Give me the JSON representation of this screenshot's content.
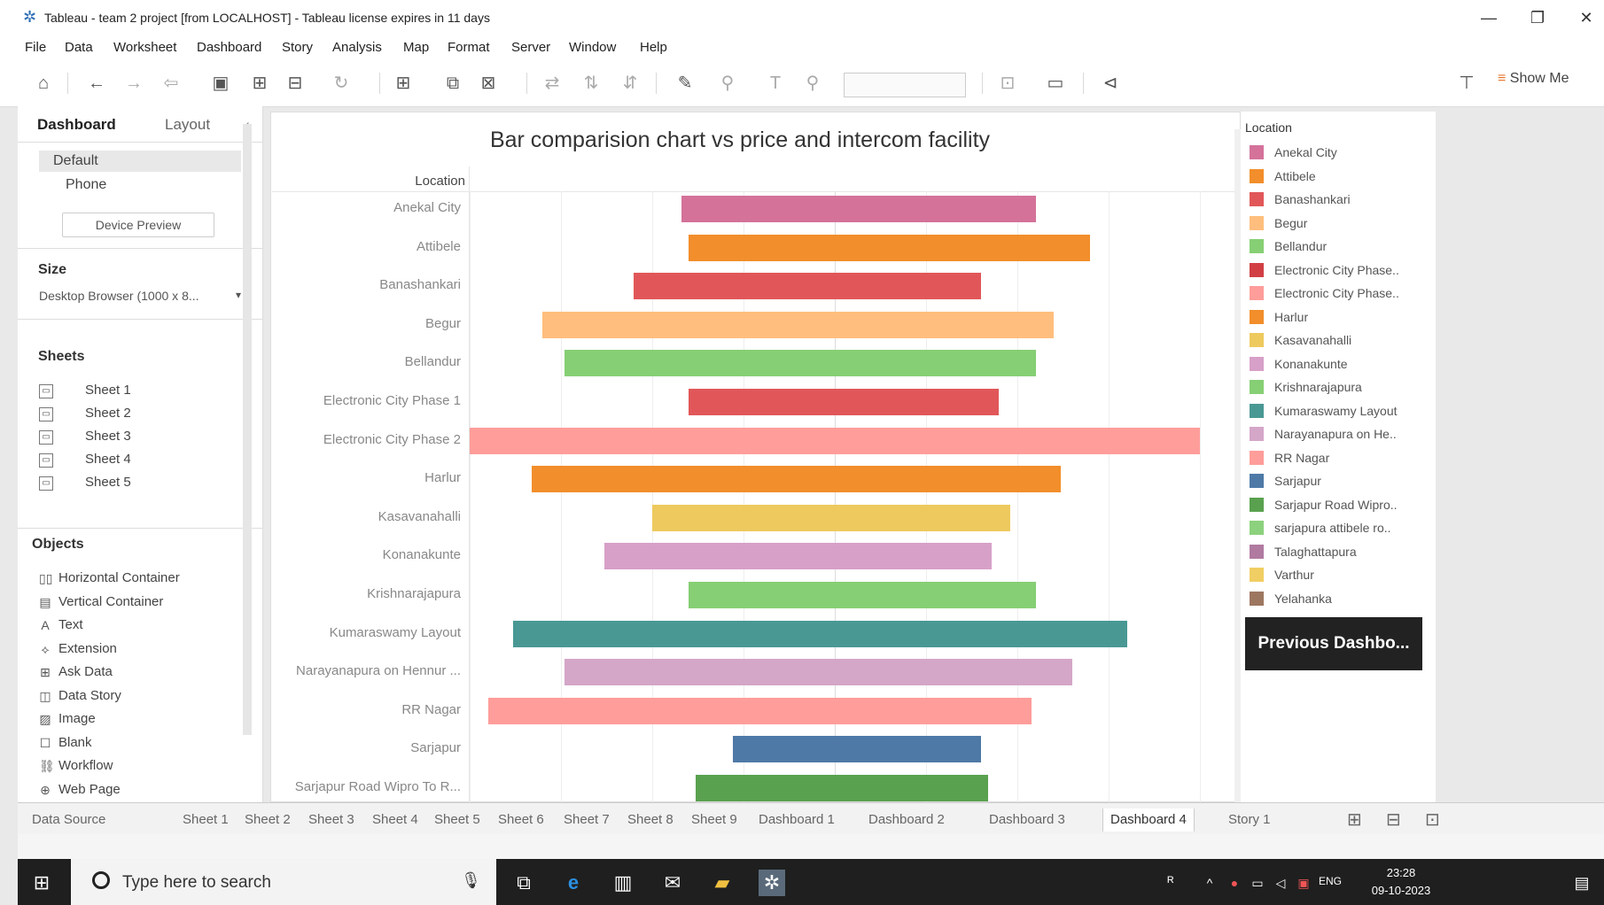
{
  "window": {
    "title": "Tableau - team 2 project [from LOCALHOST] - Tableau license expires in 11 days",
    "min_glyph": "—",
    "max_glyph": "❐",
    "close_glyph": "✕"
  },
  "menu": [
    "File",
    "Data",
    "Worksheet",
    "Dashboard",
    "Story",
    "Analysis",
    "Map",
    "Format",
    "Server",
    "Window",
    "Help"
  ],
  "toolbar": {
    "show_me_label": "Show Me"
  },
  "left_panel": {
    "tabs": [
      "Dashboard",
      "Layout"
    ],
    "collapse_glyph": "‹",
    "device_options": [
      "Default",
      "Phone"
    ],
    "device_preview_label": "Device Preview",
    "size_section": "Size",
    "size_value": "Desktop Browser (1000 x 8...",
    "sheets_section": "Sheets",
    "sheets": [
      "Sheet 1",
      "Sheet 2",
      "Sheet 3",
      "Sheet 4",
      "Sheet 5"
    ],
    "objects_section": "Objects",
    "objects": [
      {
        "label": "Horizontal Container",
        "icon": "▯▯"
      },
      {
        "label": "Vertical Container",
        "icon": "▤"
      },
      {
        "label": "Text",
        "icon": "A"
      },
      {
        "label": "Extension",
        "icon": "⟡"
      },
      {
        "label": "Ask Data",
        "icon": "⊞"
      },
      {
        "label": "Data Story",
        "icon": "◫"
      },
      {
        "label": "Image",
        "icon": "▨"
      },
      {
        "label": "Blank",
        "icon": "☐"
      },
      {
        "label": "Workflow",
        "icon": "⛓"
      },
      {
        "label": "Web Page",
        "icon": "⊕"
      }
    ]
  },
  "chart_data": {
    "type": "bar",
    "title": "Bar comparision chart vs price and intercom facility",
    "row_header": "Location",
    "categories": [
      "Anekal City",
      "Attibele",
      "Banashankari",
      "Begur",
      "Bellandur",
      "Electronic City Phase 1",
      "Electronic City Phase 2",
      "Harlur",
      "Kasavanahalli",
      "Konanakunte",
      "Krishnarajapura",
      "Kumaraswamy Layout",
      "Narayanapura on Hennur ...",
      "RR Nagar",
      "Sarjapur",
      "Sarjapur Road Wipro To R..."
    ],
    "series": [
      {
        "values": [
          [
            -0.42,
            0.55
          ],
          [
            -0.4,
            0.7
          ],
          [
            -0.55,
            0.4
          ],
          [
            -0.8,
            0.6
          ],
          [
            -0.74,
            0.55
          ],
          [
            -0.4,
            0.45
          ],
          [
            -1.0,
            1.0
          ],
          [
            -0.83,
            0.62
          ],
          [
            -0.5,
            0.48
          ],
          [
            -0.63,
            0.43
          ],
          [
            -0.4,
            0.55
          ],
          [
            -0.88,
            0.8
          ],
          [
            -0.74,
            0.65
          ],
          [
            -0.95,
            0.54
          ],
          [
            -0.28,
            0.4
          ],
          [
            -0.38,
            0.42
          ]
        ]
      }
    ],
    "colors": [
      "#d4729a",
      "#f28e2b",
      "#e15759",
      "#ffbe7d",
      "#86cf74",
      "#e15759",
      "#ff9d9a",
      "#f28e2b",
      "#eec95e",
      "#d7a0c8",
      "#86cf74",
      "#499894",
      "#d4a6c8",
      "#ff9d9a",
      "#4e79a7",
      "#59a14f"
    ]
  },
  "legend": {
    "title": "Location",
    "items": [
      {
        "label": "Anekal City",
        "color": "#d4729a"
      },
      {
        "label": "Attibele",
        "color": "#f28e2b"
      },
      {
        "label": "Banashankari",
        "color": "#e15759"
      },
      {
        "label": "Begur",
        "color": "#ffbe7d"
      },
      {
        "label": "Bellandur",
        "color": "#86cf74"
      },
      {
        "label": "Electronic City Phase..",
        "color": "#d13f44"
      },
      {
        "label": "Electronic City Phase..",
        "color": "#ff9d9a"
      },
      {
        "label": "Harlur",
        "color": "#f28e2b"
      },
      {
        "label": "Kasavanahalli",
        "color": "#eec95e"
      },
      {
        "label": "Konanakunte",
        "color": "#d7a0c8"
      },
      {
        "label": "Krishnarajapura",
        "color": "#86cf74"
      },
      {
        "label": "Kumaraswamy Layout",
        "color": "#499894"
      },
      {
        "label": "Narayanapura on He..",
        "color": "#d4a6c8"
      },
      {
        "label": "RR Nagar",
        "color": "#ff9d9a"
      },
      {
        "label": "Sarjapur",
        "color": "#4e79a7"
      },
      {
        "label": "Sarjapur Road Wipro..",
        "color": "#59a14f"
      },
      {
        "label": "sarjapura attibele ro..",
        "color": "#8cd17d"
      },
      {
        "label": "Talaghattapura",
        "color": "#b07aa1"
      },
      {
        "label": "Varthur",
        "color": "#f1ce63"
      },
      {
        "label": "Yelahanka",
        "color": "#9d7660"
      }
    ],
    "prev_button": "Previous Dashbo..."
  },
  "tabs": [
    "Data Source",
    "Sheet 1",
    "Sheet 2",
    "Sheet 3",
    "Sheet 4",
    "Sheet 5",
    "Sheet 6",
    "Sheet 7",
    "Sheet 8",
    "Sheet 9",
    "Dashboard 1",
    "Dashboard 2",
    "Dashboard 3",
    "Dashboard 4",
    "Story 1"
  ],
  "active_tab": "Dashboard 4",
  "taskbar": {
    "search_placeholder": "Type here to search",
    "lang": "ENG",
    "time": "23:28",
    "date": "09-10-2023"
  }
}
